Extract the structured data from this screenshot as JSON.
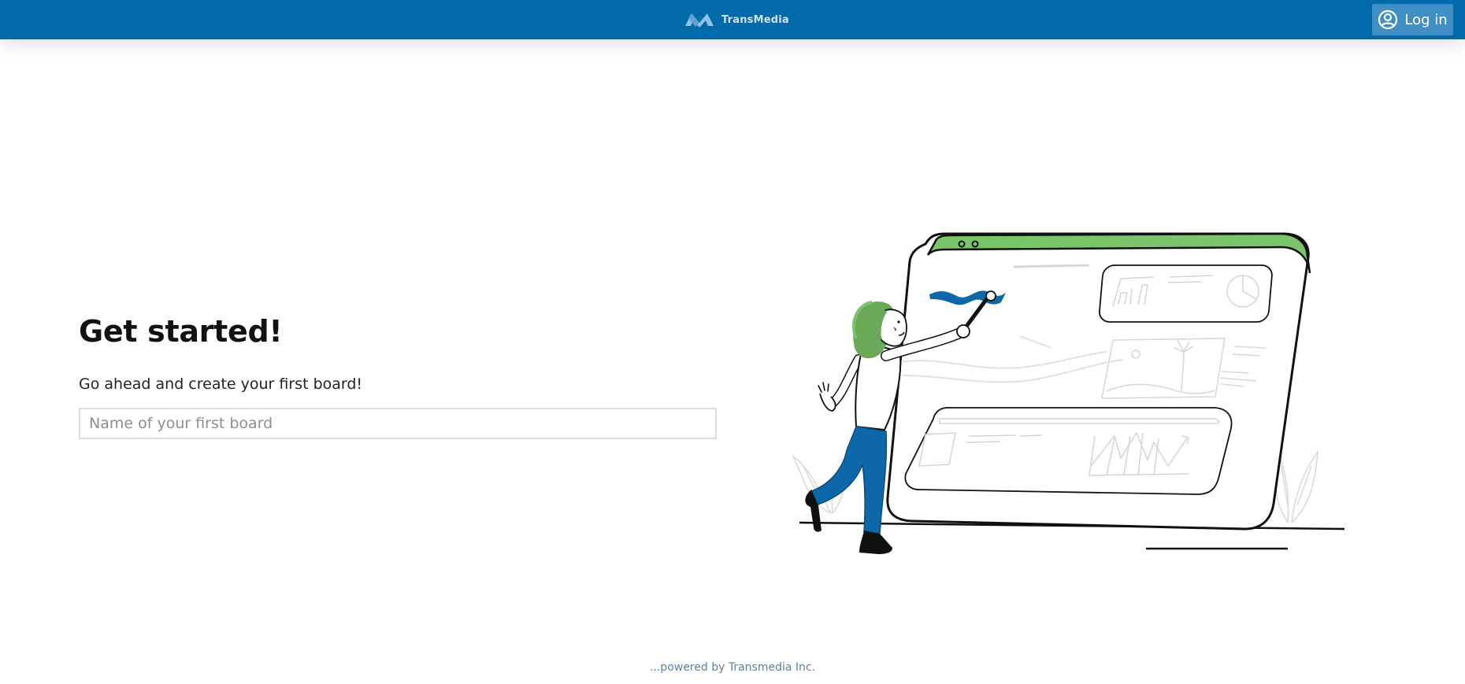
{
  "header": {
    "brand_name": "TransMedia",
    "brand_logo_icon": "transmedia-m-logo-icon",
    "login_label": "Log in",
    "login_icon": "user-circle-icon",
    "background_color": "#006aab"
  },
  "main": {
    "heading": "Get started!",
    "subtext": "Go ahead and create your first board!",
    "board_name_input": {
      "value": "",
      "placeholder": "Name of your first board"
    },
    "illustration_icon": "person-painting-board-illustration",
    "accent_colors": {
      "green": "#7cc46a",
      "blue": "#0d68aa"
    }
  },
  "footer": {
    "text": "...powered by Transmedia Inc."
  }
}
